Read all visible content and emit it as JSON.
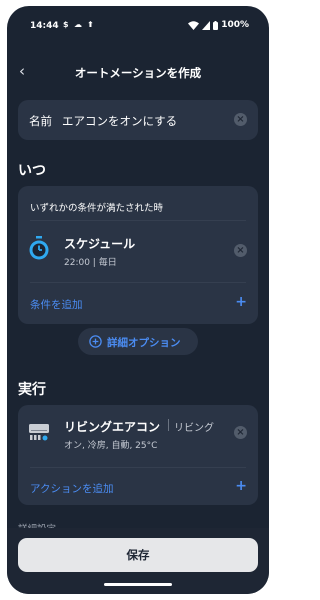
{
  "status": {
    "time": "14:44",
    "battery": "100%"
  },
  "header": {
    "title": "オートメーションを作成"
  },
  "name_field": {
    "label": "名前",
    "value": "エアコンをオンにする"
  },
  "when": {
    "section_title": "いつ",
    "condition_mode": "いずれかの条件が満たされた時",
    "schedule": {
      "title": "スケジュール",
      "detail": "22:00 | 毎日"
    },
    "add_condition_label": "条件を追加"
  },
  "advanced_options": {
    "label": "詳細オプション"
  },
  "execute": {
    "section_title": "実行",
    "device": {
      "name": "リビングエアコン",
      "room": "リビング",
      "state": "オン, 冷房, 自動, 25°C"
    },
    "add_action_label": "アクションを追加"
  },
  "details_heading": "詳細設定",
  "save": {
    "label": "保存"
  },
  "colors": {
    "background": "#1b2432",
    "card": "#2a3445",
    "accent": "#4b8cf2"
  }
}
